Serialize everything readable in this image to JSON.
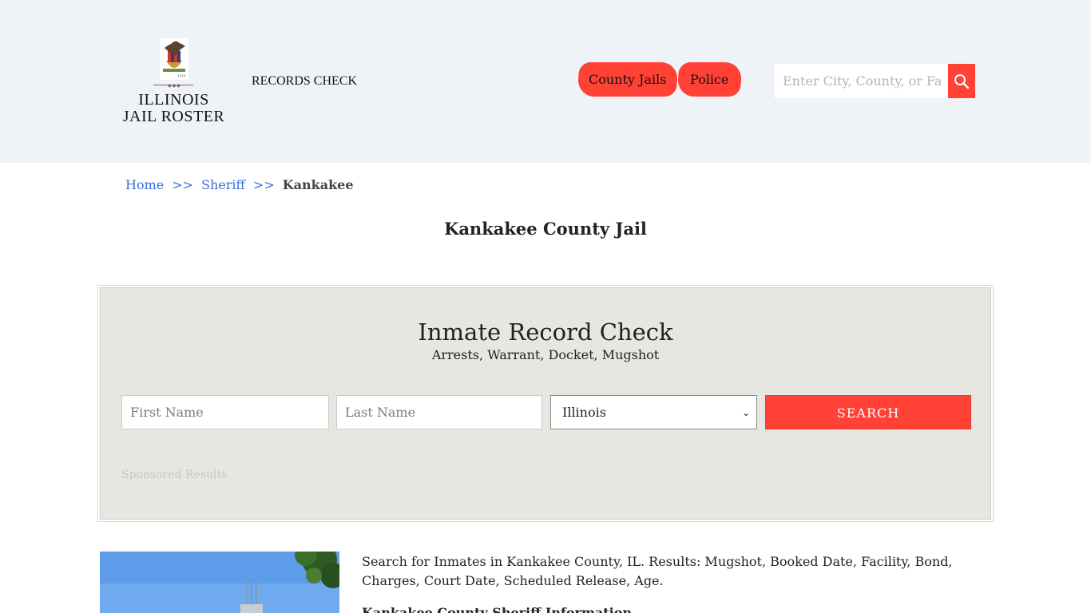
{
  "header": {
    "logo_line1": "ILLINOIS",
    "logo_line2": "JAIL ROSTER",
    "records_check_label": "RECORDS CHECK",
    "nav": [
      {
        "label": "County Jails"
      },
      {
        "label": "Police"
      }
    ],
    "search_placeholder": "Enter City, County, or Facil",
    "search_icon": "magnifier-icon"
  },
  "breadcrumb": {
    "home": "Home",
    "separator": ">>",
    "sheriff": "Sheriff",
    "current": "Kankakee"
  },
  "page_title": "Kankakee County Jail",
  "record_check": {
    "title": "Inmate Record Check",
    "subtitle": "Arrests, Warrant, Docket, Mugshot",
    "first_name_placeholder": "First Name",
    "last_name_placeholder": "Last Name",
    "state_selected": "Illinois",
    "search_label": "SEARCH",
    "sponsored_label": "Sponsored Results"
  },
  "content": {
    "intro": "Search for Inmates in Kankakee County, IL. Results: Mugshot, Booked Date, Facility, Bond, Charges, Court Date, Scheduled Release, Age.",
    "subheading": "Kankakee County Sheriff Information"
  },
  "colors": {
    "accent": "#ff4136",
    "header_bg": "#eff3f8",
    "panel_bg": "#e8e6e1",
    "link": "#3a6fd6"
  }
}
